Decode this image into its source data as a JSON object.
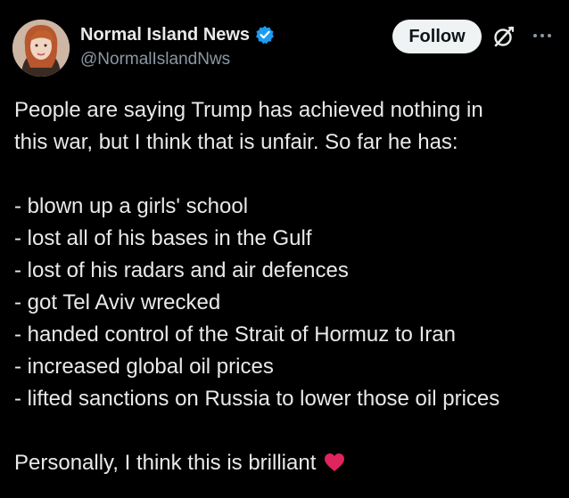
{
  "author": {
    "display_name": "Normal Island News",
    "handle": "@NormalIslandNws",
    "verified": true,
    "avatar_icon": "profile-photo"
  },
  "actions": {
    "follow_label": "Follow",
    "grok_icon": "grok-icon",
    "more_icon": "more-dots-icon"
  },
  "post": {
    "intro_lines": [
      "People are saying Trump has achieved nothing in",
      "this war, but I think that is unfair. So far he has:"
    ],
    "list_items": [
      "- blown up a girls' school",
      "- lost all of his bases in the Gulf",
      "- lost of his radars and air defences",
      "- got Tel Aviv wrecked",
      "- handed control of the Strait of Hormuz to Iran",
      "- increased global oil prices",
      "- lifted sanctions on Russia to lower those oil prices"
    ],
    "closing": "Personally, I think this is brilliant",
    "closing_emoji": "heart-icon"
  },
  "colors": {
    "background": "#000000",
    "text": "#e7e9ea",
    "secondary_text": "#8b98a5",
    "verified_blue": "#1d9bf0",
    "follow_bg": "#eff3f4",
    "heart": "#e0245e"
  }
}
